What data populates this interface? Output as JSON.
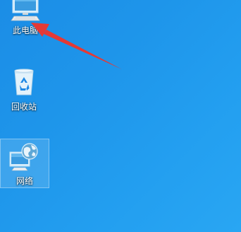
{
  "desktop": {
    "background_color": "#1e95ea",
    "icons": [
      {
        "label": "此电脑",
        "icon": "this-pc-icon"
      },
      {
        "label": "回收站",
        "icon": "recycle-bin-icon"
      },
      {
        "label": "网络",
        "icon": "network-icon",
        "selected": true
      }
    ]
  },
  "annotation": {
    "type": "arrow",
    "color": "#e53935",
    "points_to": "此电脑"
  }
}
